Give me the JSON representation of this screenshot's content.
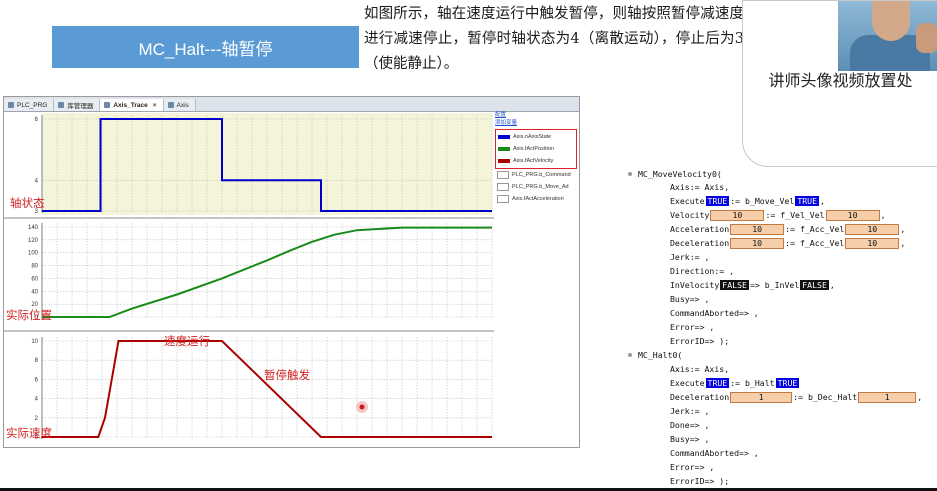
{
  "title": "MC_Halt---轴暂停",
  "description": "如图所示，轴在速度运行中触发暂停，则轴按照暂停减速度进行减速停止，暂停时轴状态为4（离散运动），停止后为3（使能静止）。",
  "presenter_caption": "讲师头像视频放置处",
  "tabs": [
    {
      "label": "PLC_PRG",
      "active": false
    },
    {
      "label": "库管理器",
      "active": false
    },
    {
      "label": "Axis_Trace",
      "active": true,
      "close": "×"
    },
    {
      "label": "Axis",
      "active": false
    }
  ],
  "legend": {
    "config_link": "配置",
    "add_var_link": "添加变量",
    "items": [
      {
        "label": "Axis.nAxisState",
        "color": "#0000cc",
        "checked": true
      },
      {
        "label": "Axis.fActPosition",
        "color": "#1a8a1a",
        "checked": true
      },
      {
        "label": "Axis.fActVelocity",
        "color": "#aa0000",
        "checked": true
      },
      {
        "label": "PLC_PRG.b_Command",
        "color": "",
        "checked": false
      },
      {
        "label": "PLC_PRG.b_Move_Ad",
        "color": "",
        "checked": false
      },
      {
        "label": "Axis.fActAcceleration",
        "color": "",
        "checked": false
      }
    ]
  },
  "annotations": {
    "state": "轴状态",
    "position": "实际位置",
    "velocity": "实际速度",
    "velocity_run": "速度运行",
    "halt_trigger": "暂停触发"
  },
  "chart_data": [
    {
      "type": "line",
      "series": [
        {
          "name": "Axis.nAxisState",
          "color": "#0000cc"
        }
      ],
      "x": [
        0,
        13,
        13,
        40,
        40,
        62,
        62,
        100
      ],
      "y": [
        3,
        3,
        6,
        6,
        4,
        4,
        3,
        3
      ],
      "ylim": [
        3,
        6
      ],
      "yticks": [
        "6",
        "4",
        "3"
      ],
      "grid": true
    },
    {
      "type": "line",
      "series": [
        {
          "name": "Axis.fActPosition",
          "color": "#1a8a1a"
        }
      ],
      "x": [
        0,
        15,
        20,
        30,
        40,
        50,
        55,
        60,
        65,
        70,
        80,
        100
      ],
      "y": [
        0,
        0,
        13,
        35,
        60,
        88,
        103,
        117,
        128,
        135,
        139,
        139
      ],
      "ylim": [
        0,
        140
      ],
      "yticks": [
        "140",
        "120",
        "100",
        "80",
        "60",
        "40",
        "20",
        "0"
      ],
      "grid": true
    },
    {
      "type": "line",
      "series": [
        {
          "name": "Axis.fActVelocity",
          "color": "#aa0000"
        }
      ],
      "x": [
        0,
        12.5,
        14,
        17,
        28,
        40,
        62,
        100
      ],
      "y": [
        0,
        0,
        2,
        10,
        10,
        10,
        0,
        0
      ],
      "ylim": [
        0,
        10
      ],
      "yticks": [
        "10",
        "8",
        "6",
        "4",
        "2",
        "0"
      ],
      "grid": true
    }
  ],
  "code": {
    "block1": "MC_MoveVelocity0(",
    "block1_lines": {
      "axis": "Axis:= Axis,",
      "execute_pre": "Execute",
      "execute_val": "TRUE",
      "execute_mid": ":= b_Move_Vel",
      "execute_val2": "TRUE",
      "execute_end": ",",
      "velocity_pre": "Velocity",
      "velocity_val": "10",
      "velocity_mid": ":= f_Vel_Vel",
      "velocity_val2": "10",
      "acc_pre": "Acceleration",
      "acc_val": "10",
      "acc_mid": ":= f_Acc_Vel",
      "acc_val2": "10",
      "dec_pre": "Deceleration",
      "dec_val": "10",
      "dec_mid": ":= f_Acc_Vel",
      "dec_val2": "10",
      "jerk": "Jerk:= ,",
      "direction": "Direction:= ,",
      "invel_pre": "InVelocity",
      "invel_val": "FALSE",
      "invel_mid": "=> b_InVel",
      "invel_val2": "FALSE",
      "busy": "Busy=> ,",
      "cmdab": "CommandAborted=> ,",
      "error": "Error=> ,",
      "errorid": "ErrorID=> );"
    },
    "block2": "MC_Halt0(",
    "block2_lines": {
      "axis": "Axis:= Axis,",
      "execute_pre": "Execute",
      "execute_val": "TRUE",
      "execute_mid": ":= b_Halt",
      "execute_val2": "TRUE",
      "dec_pre": "Deceleration",
      "dec_val": "1",
      "dec_mid": ":= b_Dec_Halt",
      "dec_val2": "1",
      "jerk": "Jerk:= ,",
      "done": "Done=> ,",
      "busy": "Busy=> ,",
      "cmdab": "CommandAborted=> ,",
      "error": "Error=> ,",
      "errorid": "ErrorID=> );"
    }
  }
}
